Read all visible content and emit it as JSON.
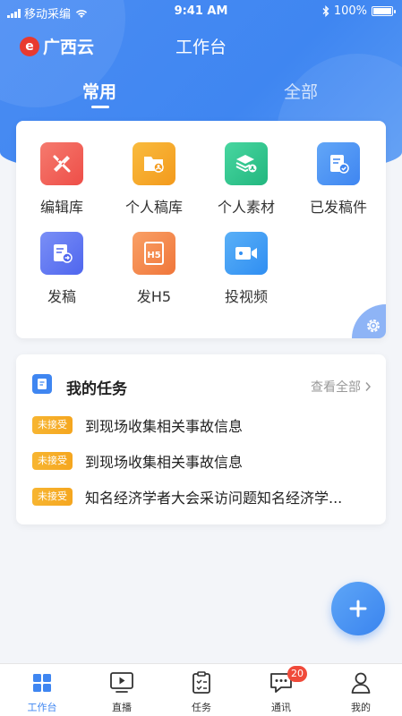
{
  "status_bar": {
    "carrier": "移动采编",
    "time": "9:41 AM",
    "battery": "100%",
    "battery_level": 1.0
  },
  "header": {
    "brand": "广西云",
    "title": "工作台"
  },
  "tabs": [
    {
      "label": "常用",
      "active": true
    },
    {
      "label": "全部",
      "active": false
    }
  ],
  "tools": [
    {
      "label": "编辑库",
      "icon": "ruler-pencil-icon",
      "color": "#f0605a"
    },
    {
      "label": "个人稿库",
      "icon": "folder-user-icon",
      "color": "#f5a522"
    },
    {
      "label": "个人素材",
      "icon": "layers-user-icon",
      "color": "#2fc48d"
    },
    {
      "label": "已发稿件",
      "icon": "document-check-icon",
      "color": "#4b94f4"
    },
    {
      "label": "发稿",
      "icon": "document-send-icon",
      "color": "#5b73f2"
    },
    {
      "label": "发H5",
      "icon": "h5-icon",
      "color": "#f4894a"
    },
    {
      "label": "投视频",
      "icon": "video-camera-icon",
      "color": "#3a9af4"
    }
  ],
  "tasks": {
    "title": "我的任务",
    "view_all": "查看全部",
    "items": [
      {
        "status": "未接受",
        "text": "到现场收集相关事故信息"
      },
      {
        "status": "未接受",
        "text": "到现场收集相关事故信息"
      },
      {
        "status": "未接受",
        "text": "知名经济学者大会采访问题知名经济学..."
      }
    ]
  },
  "bottom_nav": [
    {
      "label": "工作台",
      "icon": "grid-icon",
      "active": true
    },
    {
      "label": "直播",
      "icon": "live-play-icon",
      "active": false
    },
    {
      "label": "任务",
      "icon": "clipboard-icon",
      "active": false
    },
    {
      "label": "通讯",
      "icon": "chat-icon",
      "active": false,
      "badge": "20"
    },
    {
      "label": "我的",
      "icon": "person-icon",
      "active": false
    }
  ]
}
